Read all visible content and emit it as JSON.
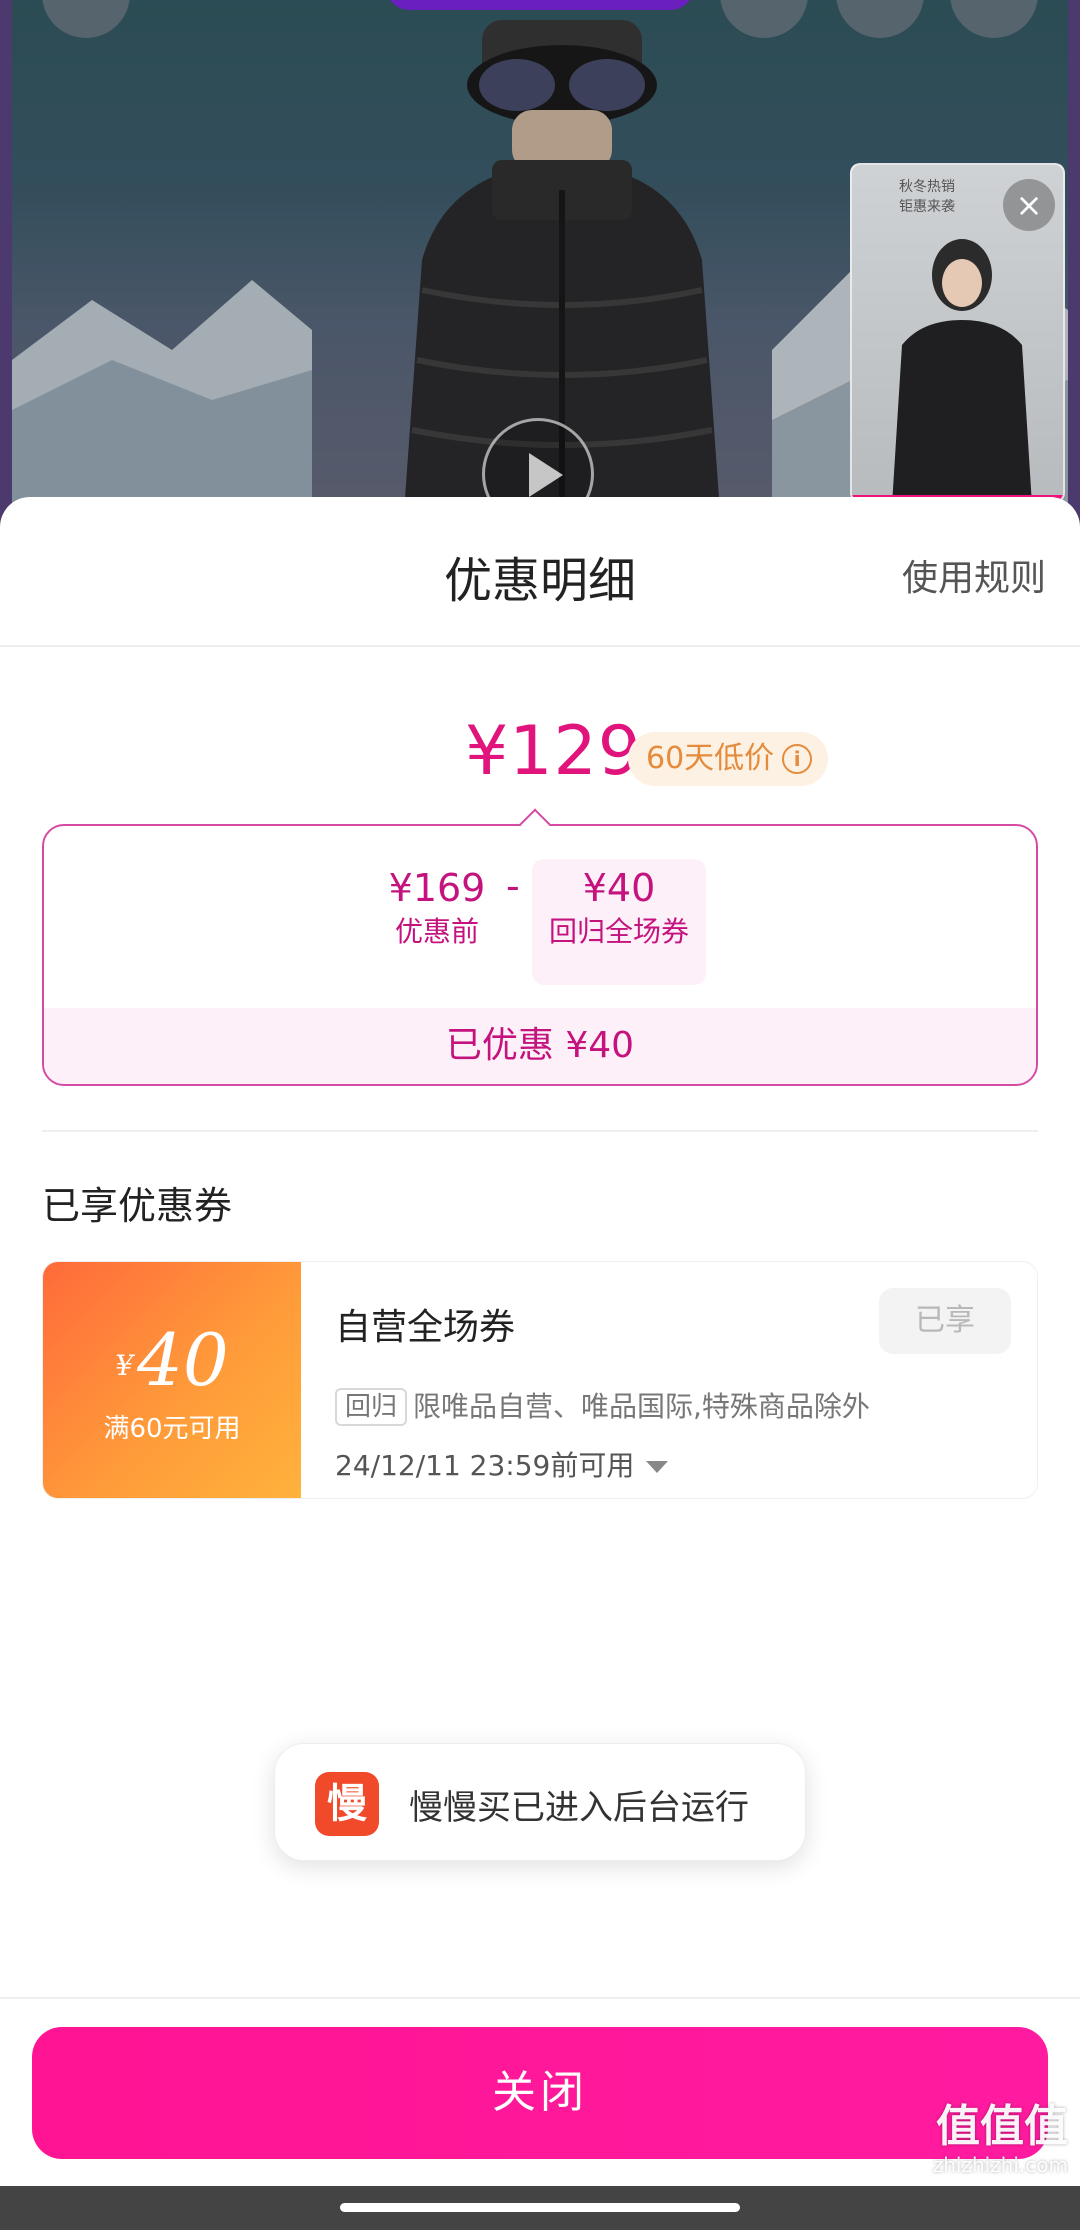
{
  "banner": {
    "mini_video_caption_line1": "秋冬热销",
    "mini_video_caption_line2": "钜惠来袭",
    "mini_close_glyph": "×",
    "icons": [
      "back-icon",
      "add-icon",
      "bag-icon",
      "more-icon",
      "play-icon"
    ]
  },
  "sheet": {
    "title": "优惠明细",
    "rules_link": "使用规则"
  },
  "price": {
    "final": "¥129",
    "low_badge": "60天低价",
    "info_glyph": "i"
  },
  "calculation": {
    "original_amount": "¥169",
    "original_label": "优惠前",
    "minus": "-",
    "coupon_amount": "¥40",
    "coupon_label": "回归全场券",
    "total_saved": "已优惠 ¥40"
  },
  "coupons_section": {
    "title": "已享优惠券",
    "items": [
      {
        "currency": "¥",
        "amount": "40",
        "condition": "满60元可用",
        "name": "自营全场券",
        "status": "已享",
        "tag": "回归",
        "scope": "限唯品自营、唯品国际,特殊商品除外",
        "expiry": "24/12/11 23:59前可用"
      }
    ]
  },
  "toast": {
    "icon_glyph": "慢",
    "text": "慢慢买已进入后台运行"
  },
  "footer": {
    "close_label": "关闭"
  },
  "watermark": {
    "big": "值值值",
    "small": "zhizhizhi.com"
  },
  "colors": {
    "accent": "#e0147c",
    "button": "#ff1493",
    "coupon_gradient_start": "#ff6a3a",
    "coupon_gradient_end": "#ffb23c",
    "badge_text": "#e58b3c"
  }
}
